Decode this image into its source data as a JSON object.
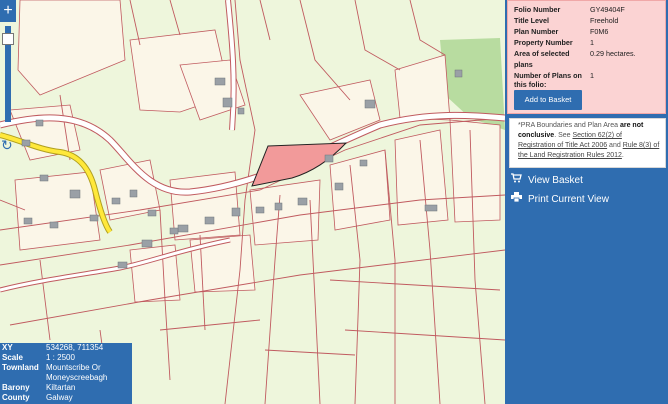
{
  "map": {
    "zoom_in_label": "+",
    "refresh_icon": "↻",
    "colors": {
      "background": "#eef6dc",
      "parcel_fill": "#fbf6e8",
      "parcel_line": "#b7444a",
      "road_major": "#ffffff",
      "road_regional": "#ffe83a",
      "selected_parcel": "#f29a9a",
      "building": "#9aa0a6",
      "woodland": "#b8dca0"
    }
  },
  "map_info": {
    "rows": [
      {
        "key": "XY",
        "value": "534268, 711354"
      },
      {
        "key": "Scale",
        "value": "1 : 2500"
      },
      {
        "key": "Townland",
        "value": "Mountscribe Or Moneyscreebagh"
      },
      {
        "key": "Barony",
        "value": "Kiltartan"
      },
      {
        "key": "County",
        "value": "Galway"
      }
    ]
  },
  "folio": {
    "rows": [
      {
        "key": "Folio Number",
        "value": "GY49404F"
      },
      {
        "key": "Title Level",
        "value": "Freehold"
      },
      {
        "key": "Plan Number",
        "value": "F0M6"
      },
      {
        "key": "Property Number",
        "value": "1"
      },
      {
        "key": "Area of selected plans",
        "value": "0.29 hectares."
      },
      {
        "key": "Number of Plans on this folio:",
        "value": "1"
      },
      {
        "key": "Address",
        "value": ""
      }
    ],
    "add_to_basket": "Add to Basket"
  },
  "notice": {
    "prefix": "*PRA Boundaries and Plan Area ",
    "bold": "are not conclusive",
    "see": ". See ",
    "link1": "Section 62(2) of Registration of Title Act 2006",
    "and": " and ",
    "link2": "Rule 8(3) of the Land Registration Rules 2012",
    "end": "."
  },
  "menu": {
    "view_basket": "View Basket",
    "print_view": "Print Current View",
    "cart_icon": "cart-icon",
    "print_icon": "print-icon"
  }
}
